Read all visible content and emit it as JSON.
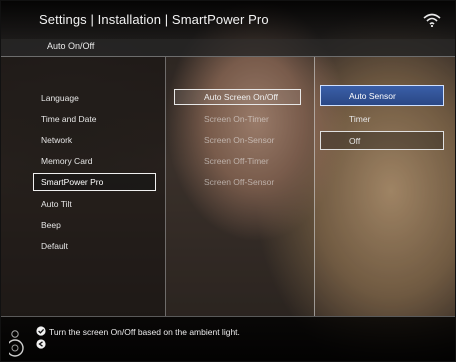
{
  "header": {
    "title": "Settings | Installation | SmartPower Pro",
    "subtitle": "Auto On/Off",
    "wifi_icon": "wifi-icon"
  },
  "left_menu": {
    "items": [
      {
        "label": "Language"
      },
      {
        "label": "Time and Date"
      },
      {
        "label": "Network"
      },
      {
        "label": "Memory Card"
      },
      {
        "label": "SmartPower Pro"
      },
      {
        "label": "Auto Tilt"
      },
      {
        "label": "Beep"
      },
      {
        "label": "Default"
      }
    ],
    "selected_index": 4
  },
  "middle_menu": {
    "items": [
      {
        "label": "Auto Screen On/Off"
      },
      {
        "label": "Screen On-Timer"
      },
      {
        "label": "Screen On-Sensor"
      },
      {
        "label": "Screen Off-Timer"
      },
      {
        "label": "Screen Off-Sensor"
      }
    ],
    "selected_index": 0
  },
  "options": {
    "items": [
      {
        "label": "Auto Sensor"
      },
      {
        "label": "Timer"
      },
      {
        "label": "Off"
      }
    ],
    "focused_index": 0,
    "current_index": 2
  },
  "help": {
    "text": "Turn the screen On/Off based on the ambient light.",
    "icons": [
      "navigation-ring-icon",
      "ok-icon",
      "back-icon"
    ]
  },
  "colors": {
    "focus_blue": "#2f52a0",
    "text": "#e6e6e6"
  }
}
